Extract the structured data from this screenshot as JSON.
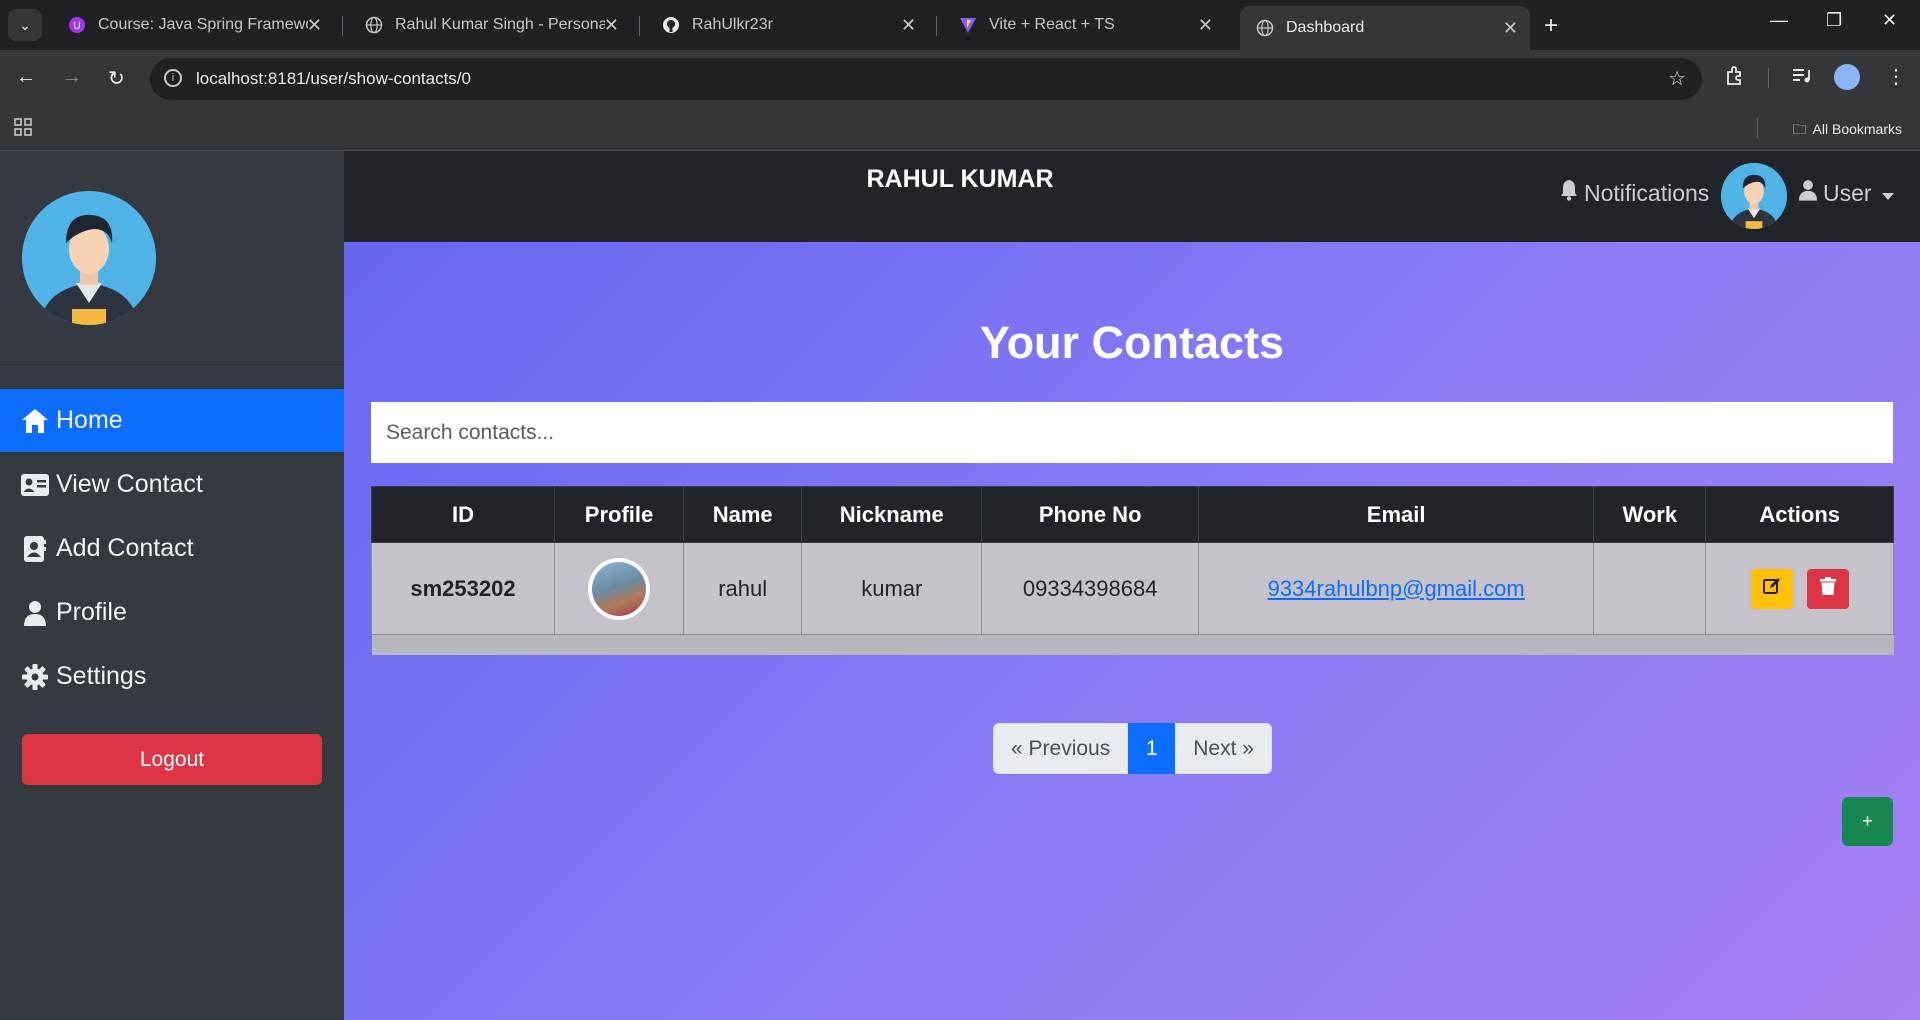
{
  "browser": {
    "tabs": [
      {
        "title": "Course: Java Spring Framework",
        "favicon": "udemy-icon"
      },
      {
        "title": "Rahul Kumar Singh - Personal P",
        "favicon": "globe-icon"
      },
      {
        "title": "RahUlkr23r",
        "favicon": "github-icon"
      },
      {
        "title": "Vite + React + TS",
        "favicon": "vite-icon"
      },
      {
        "title": "Dashboard",
        "favicon": "globe-icon",
        "active": true
      }
    ],
    "url": "localhost:8181/user/show-contacts/0",
    "all_bookmarks": "All Bookmarks"
  },
  "app": {
    "brand": "RAHUL KUMAR",
    "notifications": "Notifications",
    "user_menu": "User"
  },
  "sidebar": {
    "items": [
      {
        "label": "Home",
        "icon": "home-icon",
        "active": true
      },
      {
        "label": "View Contact",
        "icon": "id-card-icon"
      },
      {
        "label": "Add Contact",
        "icon": "contact-book-icon"
      },
      {
        "label": "Profile",
        "icon": "user-icon"
      },
      {
        "label": "Settings",
        "icon": "gear-icon"
      }
    ],
    "logout": "Logout"
  },
  "main": {
    "heading": "Your Contacts",
    "search_placeholder": "Search contacts...",
    "table": {
      "columns": [
        "ID",
        "Profile",
        "Name",
        "Nickname",
        "Phone No",
        "Email",
        "Work",
        "Actions"
      ],
      "rows": [
        {
          "id": "sm253202",
          "name": "rahul",
          "nickname": "kumar",
          "phone": "09334398684",
          "email": "9334rahulbnp@gmail.com",
          "work": ""
        }
      ]
    },
    "pagination": {
      "previous": "« Previous",
      "current": "1",
      "next": "Next »"
    },
    "fab": "+"
  },
  "colors": {
    "accent": "#0d6efd",
    "danger": "#dc3545",
    "warning": "#ffc107",
    "success": "#198754",
    "navbar": "#212529",
    "sidebar": "#343a40"
  }
}
